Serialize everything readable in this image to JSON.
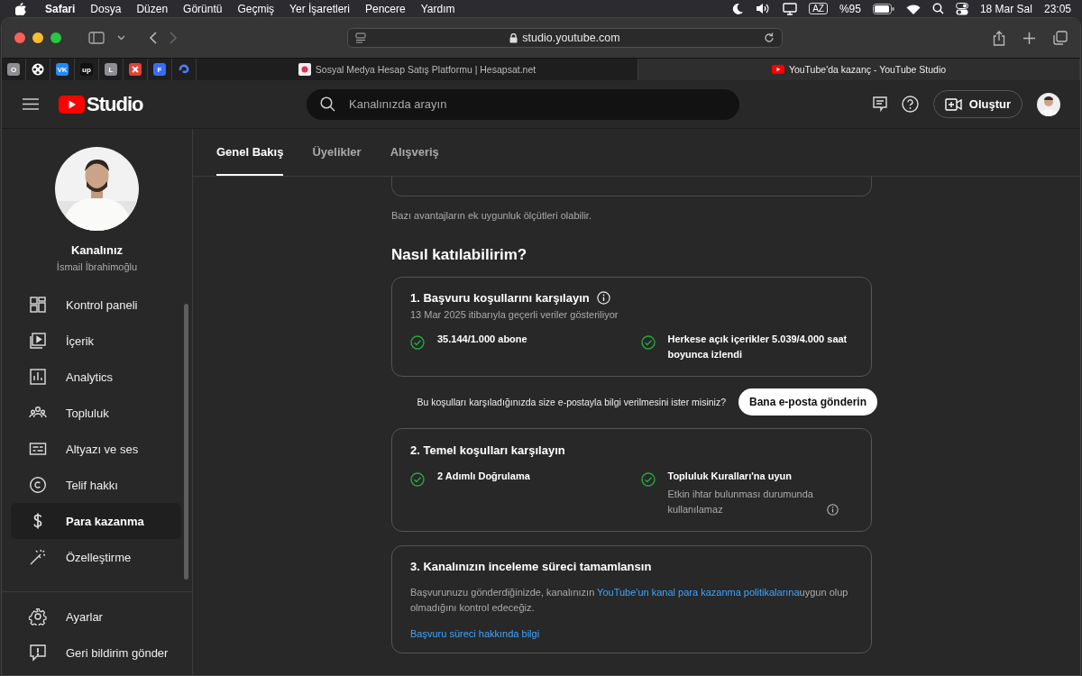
{
  "menubar": {
    "app": "Safari",
    "menus": [
      "Dosya",
      "Düzen",
      "Görüntü",
      "Geçmiş",
      "Yer İşaretleri",
      "Pencere",
      "Yardım"
    ],
    "input_source": "AZ",
    "battery": "%95",
    "date": "18 Mar Sal",
    "time": "23:05"
  },
  "browser": {
    "url": "studio.youtube.com",
    "pinned_tabs": [
      {
        "kind": "letter",
        "label": "O",
        "color": "#8e8e93"
      },
      {
        "kind": "reel",
        "color": "#ffffff"
      },
      {
        "kind": "letter",
        "label": "VK",
        "color": "#2787f5"
      },
      {
        "kind": "letter",
        "label": "up",
        "color": "#111111"
      },
      {
        "kind": "letter",
        "label": "L",
        "color": "#8e8e93"
      },
      {
        "kind": "cross",
        "color": "#e0423a"
      },
      {
        "kind": "letter",
        "label": "F",
        "color": "#3b6cf0"
      },
      {
        "kind": "swirl",
        "color": "#4f7cff"
      }
    ],
    "tabs": [
      {
        "title": "Sosyal Medya Hesap Satış Platformu | Hesapsat.net",
        "selected": false
      },
      {
        "title": "YouTube'da kazanç - YouTube Studio",
        "selected": true
      }
    ]
  },
  "header": {
    "logo": "Studio",
    "search": {
      "placeholder": "Kanalınızda arayın"
    },
    "create_button": "Oluştur"
  },
  "sidebar": {
    "channel_label": "Kanalınız",
    "channel_name": "İsmail İbrahimoğlu",
    "items": [
      {
        "label": "Kontrol paneli",
        "selected": false
      },
      {
        "label": "İçerik",
        "selected": false
      },
      {
        "label": "Analytics",
        "selected": false
      },
      {
        "label": "Topluluk",
        "selected": false
      },
      {
        "label": "Altyazı ve ses",
        "selected": false
      },
      {
        "label": "Telif hakkı",
        "selected": false
      },
      {
        "label": "Para kazanma",
        "selected": true
      },
      {
        "label": "Özelleştirme",
        "selected": false
      }
    ],
    "footer_items": [
      "Ayarlar",
      "Geri bildirim gönder"
    ]
  },
  "tabs": [
    {
      "label": "Genel Bakış",
      "selected": true
    },
    {
      "label": "Üyelikler",
      "selected": false
    },
    {
      "label": "Alışveriş",
      "selected": false
    }
  ],
  "eligibility_note": "Bazı avantajların ek uygunluk ölçütleri olabilir.",
  "section_title": "Nasıl katılabilirim?",
  "steps": [
    {
      "kind": "requirements",
      "title": "1. Başvuru koşullarını karşılayın",
      "info": true,
      "subtitle": "13 Mar 2025 itibarıyla geçerli veriler gösteriliyor",
      "requirements": [
        {
          "text": "35.144/1.000 abone",
          "met": true
        },
        {
          "text": "Herkese açık içerikler 5.039/4.000 saat boyunca izlendi",
          "met": true
        }
      ]
    },
    {
      "kind": "email_prompt",
      "text": "Bu koşulları karşıladığınızda size e-postayla bilgi verilmesini ister misiniz?",
      "button": "Bana e-posta gönderin"
    },
    {
      "kind": "requirements",
      "title": "2. Temel koşulları karşılayın",
      "info": false,
      "requirements": [
        {
          "text": "2 Adımlı Doğrulama",
          "met": true
        },
        {
          "text": "Topluluk Kuralları'na uyun",
          "met": true,
          "note": "Etkin ihtar bulunması durumunda kullanılamaz",
          "info": true
        }
      ]
    },
    {
      "kind": "review",
      "title": "3. Kanalınızın inceleme süreci tamamlansın",
      "text_before": "Başvurunuzu gönderdiğinizde, kanalınızın ",
      "link": "YouTube'un kanal para kazanma politikalarına",
      "text_after": "uygun olup olmadığını kontrol edeceğiz.",
      "footer_link": "Başvuru süreci hakkında bilgi"
    }
  ]
}
